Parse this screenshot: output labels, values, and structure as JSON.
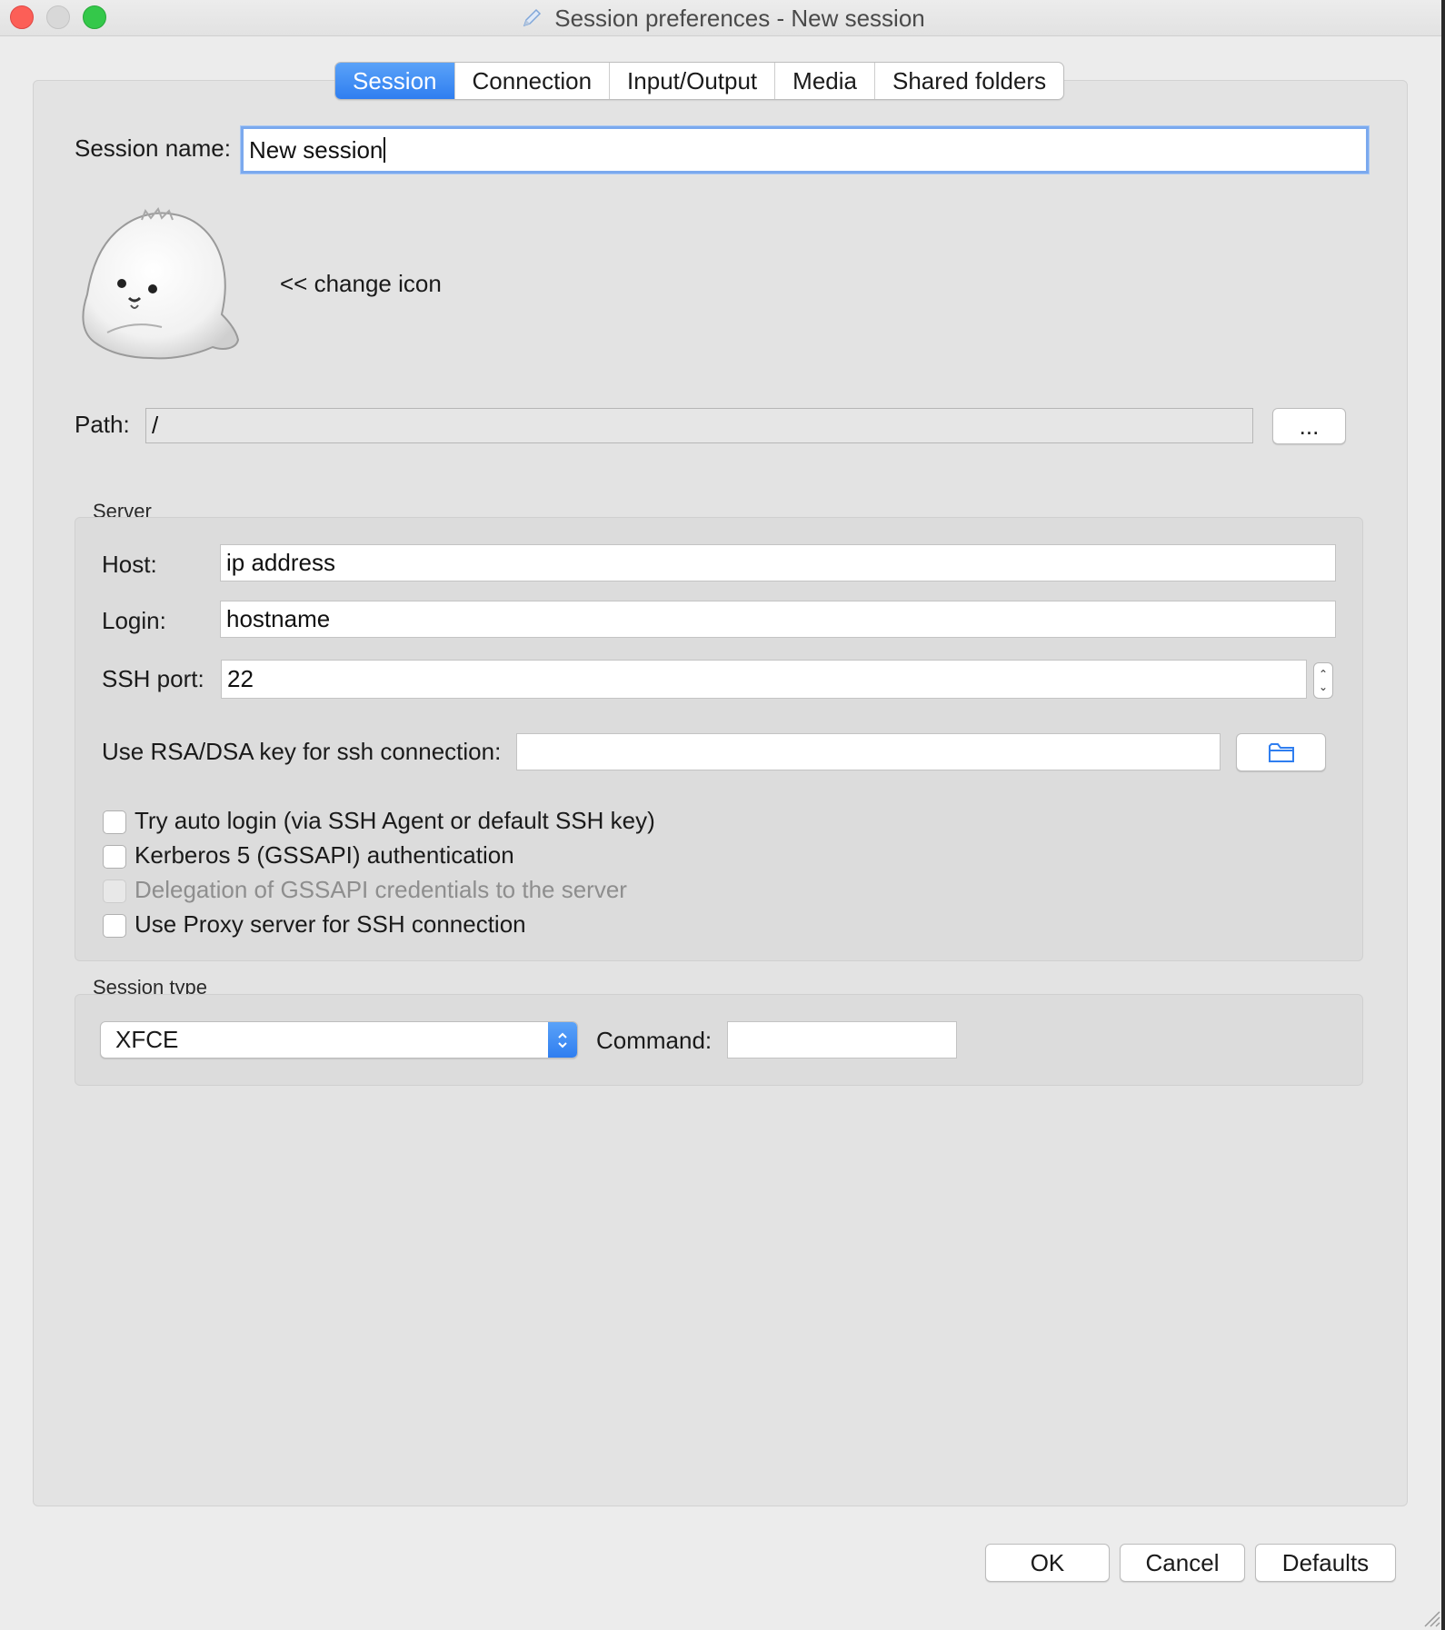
{
  "window": {
    "title": "Session preferences - New session"
  },
  "tabs": [
    {
      "label": "Session",
      "active": true
    },
    {
      "label": "Connection",
      "active": false
    },
    {
      "label": "Input/Output",
      "active": false
    },
    {
      "label": "Media",
      "active": false
    },
    {
      "label": "Shared folders",
      "active": false
    }
  ],
  "session": {
    "name_label": "Session name:",
    "name_value": "New session",
    "change_icon_label": "<< change icon",
    "path_label": "Path:",
    "path_value": "/",
    "path_browse_label": "..."
  },
  "server": {
    "group_title": "Server",
    "host_label": "Host:",
    "host_value": "ip address",
    "login_label": "Login:",
    "login_value": "hostname",
    "ssh_port_label": "SSH port:",
    "ssh_port_value": "22",
    "rsa_label": "Use RSA/DSA key for ssh connection:",
    "rsa_value": "",
    "options": [
      {
        "label": "Try auto login (via SSH Agent or default SSH key)",
        "checked": false,
        "enabled": true
      },
      {
        "label": "Kerberos 5 (GSSAPI) authentication",
        "checked": false,
        "enabled": true
      },
      {
        "label": "Delegation of GSSAPI credentials to the server",
        "checked": false,
        "enabled": false
      },
      {
        "label": "Use Proxy server for SSH connection",
        "checked": false,
        "enabled": true
      }
    ]
  },
  "session_type": {
    "group_title": "Session type",
    "selected": "XFCE",
    "command_label": "Command:",
    "command_value": ""
  },
  "footer": {
    "ok_label": "OK",
    "cancel_label": "Cancel",
    "defaults_label": "Defaults"
  },
  "colors": {
    "accent": "#3a86f4",
    "close": "#fc5f57",
    "maximize": "#34c84a"
  }
}
